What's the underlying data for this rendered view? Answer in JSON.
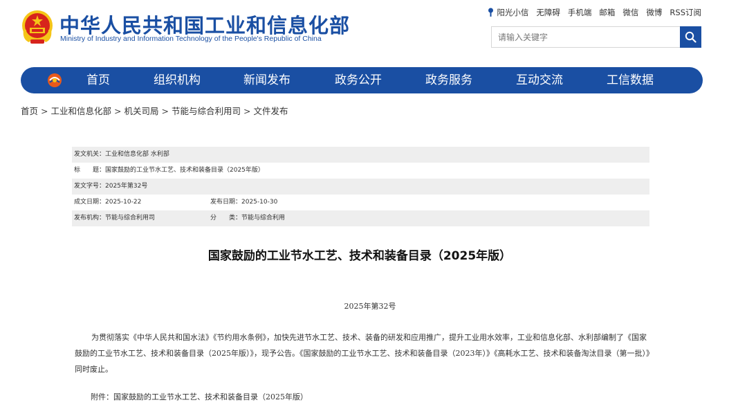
{
  "header": {
    "site_title": "中华人民共和国工业和信息化部",
    "site_subtitle": "Ministry of Industry and Information Technology of the People's Republic of China",
    "top_links": [
      "阳光小信",
      "无障碍",
      "手机端",
      "邮箱",
      "微信",
      "微博",
      "RSS订阅"
    ],
    "search_placeholder": "请输入关键字",
    "colors": {
      "brand_blue": "#1a4fa3",
      "emblem_red": "#d7241c",
      "emblem_gold": "#f5c518"
    }
  },
  "nav": {
    "items": [
      "首页",
      "组织机构",
      "新闻发布",
      "政务公开",
      "政务服务",
      "互动交流",
      "工信数据"
    ]
  },
  "breadcrumb": [
    "首页",
    "工业和信息化部",
    "机关司局",
    "节能与综合利用司",
    "文件发布"
  ],
  "meta": {
    "issuer": "发文机关：工业和信息化部 水利部",
    "title": "标　　题：国家鼓励的工业节水工艺、技术和装备目录（2025年版）",
    "doc_no": "发文字号：2025年第32号",
    "created": "成文日期：2025-10-22",
    "published": "发布日期：2025-10-30",
    "org": "发布机构：节能与综合利用司",
    "category": "分　　类：节能与综合利用"
  },
  "article": {
    "title": "国家鼓励的工业节水工艺、技术和装备目录（2025年版）",
    "number": "2025年第32号",
    "body": "为贯彻落实《中华人民共和国水法》《节约用水条例》，加快先进节水工艺、技术、装备的研发和应用推广，提升工业用水效率，工业和信息化部、水利部编制了《国家鼓励的工业节水工艺、技术和装备目录（2025年版）》，现予公告。《国家鼓励的工业节水工艺、技术和装备目录（2023年）》《高耗水工艺、技术和装备淘汰目录（第一批）》同时废止。",
    "attachment": "附件：国家鼓励的工业节水工艺、技术和装备目录（2025年版）"
  }
}
